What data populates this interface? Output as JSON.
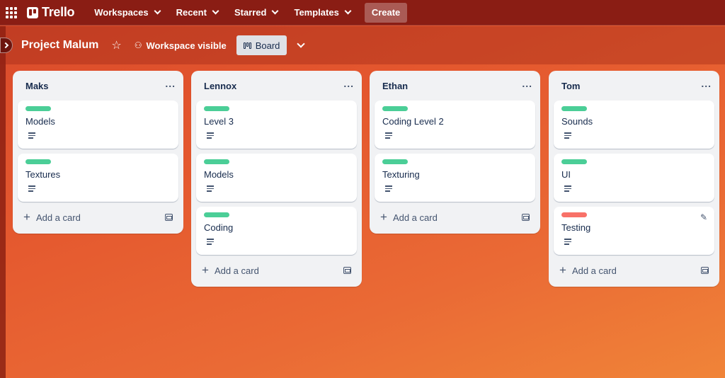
{
  "nav": {
    "logo": "Trello",
    "items": [
      {
        "label": "Workspaces"
      },
      {
        "label": "Recent"
      },
      {
        "label": "Starred"
      },
      {
        "label": "Templates"
      }
    ],
    "create_label": "Create"
  },
  "board": {
    "title": "Project Malum",
    "visibility_label": "Workspace visible",
    "view_label": "Board"
  },
  "colors": {
    "green_label": "#4bce97",
    "red_label": "#f87168",
    "nav_bg": "#8a1d14"
  },
  "lists": [
    {
      "title": "Maks",
      "cards": [
        {
          "title": "Models",
          "label_color": "#4bce97"
        },
        {
          "title": "Textures",
          "label_color": "#4bce97"
        }
      ],
      "add_label": "Add a card"
    },
    {
      "title": "Lennox",
      "cards": [
        {
          "title": "Level 3",
          "label_color": "#4bce97"
        },
        {
          "title": "Models",
          "label_color": "#4bce97"
        },
        {
          "title": "Coding",
          "label_color": "#4bce97"
        }
      ],
      "add_label": "Add a card"
    },
    {
      "title": "Ethan",
      "cards": [
        {
          "title": "Coding Level 2",
          "label_color": "#4bce97"
        },
        {
          "title": "Texturing",
          "label_color": "#4bce97"
        }
      ],
      "add_label": "Add a card"
    },
    {
      "title": "Tom",
      "cards": [
        {
          "title": "Sounds",
          "label_color": "#4bce97"
        },
        {
          "title": "UI",
          "label_color": "#4bce97"
        },
        {
          "title": "Testing",
          "label_color": "#f87168"
        }
      ],
      "add_label": "Add a card"
    }
  ]
}
